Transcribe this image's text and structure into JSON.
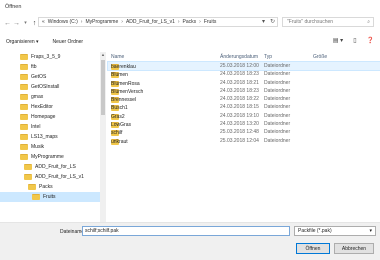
{
  "window": {
    "title": "Öffnen"
  },
  "address": {
    "path": [
      "Windows (C:)",
      "MyProgramme",
      "ADD_Fruit_for_LS_v1",
      "Packs",
      "Fruits"
    ],
    "prefix": "«"
  },
  "search": {
    "placeholder": "\"Fruits\" durchsuchen"
  },
  "toolbar": {
    "organize": "Organisieren ▾",
    "new_folder": "Neuer Ordner"
  },
  "sidebar": {
    "items": [
      {
        "label": "Fraps_3_5_9",
        "indent": 0
      },
      {
        "label": "ftb",
        "indent": 0
      },
      {
        "label": "GetOS",
        "indent": 0
      },
      {
        "label": "GetOSInstall",
        "indent": 0
      },
      {
        "label": "gmax",
        "indent": 0
      },
      {
        "label": "HexEditor",
        "indent": 0
      },
      {
        "label": "Homepage",
        "indent": 0
      },
      {
        "label": "Intel",
        "indent": 0
      },
      {
        "label": "LS13_maps",
        "indent": 0
      },
      {
        "label": "Musik",
        "indent": 0
      },
      {
        "label": "MyProgramme",
        "indent": 0
      },
      {
        "label": "ADD_Fruit_for_LS",
        "indent": 1
      },
      {
        "label": "ADD_Fruit_for_LS_v1",
        "indent": 1
      },
      {
        "label": "Packs",
        "indent": 2
      },
      {
        "label": "Fruits",
        "indent": 3
      }
    ]
  },
  "columns": {
    "name": "Name",
    "date": "Änderungsdatum",
    "type": "Typ",
    "size": "Größe"
  },
  "files": [
    {
      "name": "baerenklau",
      "date": "25.03.2018 12:00",
      "type": "Dateiordner"
    },
    {
      "name": "Blumen",
      "date": "24.03.2018 18:23",
      "type": "Dateiordner"
    },
    {
      "name": "BlumenRosa",
      "date": "24.03.2018 18:21",
      "type": "Dateiordner"
    },
    {
      "name": "BlumenVersch",
      "date": "24.03.2018 18:23",
      "type": "Dateiordner"
    },
    {
      "name": "Brennessel",
      "date": "24.03.2018 18:22",
      "type": "Dateiordner"
    },
    {
      "name": "Busch1",
      "date": "24.03.2018 18:15",
      "type": "Dateiordner"
    },
    {
      "name": "Gras2",
      "date": "24.03.2018 19:10",
      "type": "Dateiordner"
    },
    {
      "name": "LowGras",
      "date": "24.03.2018 13:20",
      "type": "Dateiordner"
    },
    {
      "name": "schilf",
      "date": "25.03.2018 12:48",
      "type": "Dateiordner"
    },
    {
      "name": "unkraut",
      "date": "25.03.2018 12:04",
      "type": "Dateiordner"
    }
  ],
  "footer": {
    "filename_label": "Dateiname:",
    "filename_value": "schilf;schilf.pak",
    "filetype": "Packfile (*.pak)",
    "open": "Öffnen",
    "cancel": "Abbrechen"
  },
  "colors": {
    "selection": "#cce8ff",
    "folder": "#f1c74a",
    "accent": "#0078d7"
  }
}
